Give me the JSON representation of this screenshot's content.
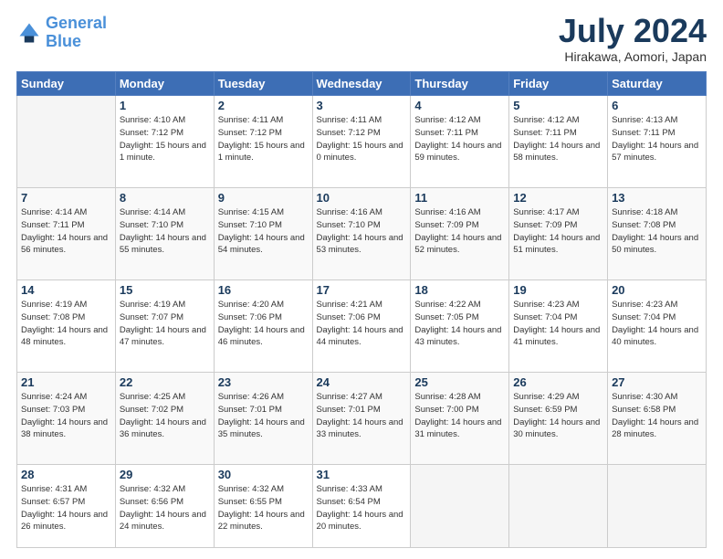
{
  "header": {
    "logo_line1": "General",
    "logo_line2": "Blue",
    "month_title": "July 2024",
    "location": "Hirakawa, Aomori, Japan"
  },
  "days_of_week": [
    "Sunday",
    "Monday",
    "Tuesday",
    "Wednesday",
    "Thursday",
    "Friday",
    "Saturday"
  ],
  "weeks": [
    [
      {
        "day": "",
        "empty": true
      },
      {
        "day": "1",
        "sunrise": "4:10 AM",
        "sunset": "7:12 PM",
        "daylight": "15 hours and 1 minute."
      },
      {
        "day": "2",
        "sunrise": "4:11 AM",
        "sunset": "7:12 PM",
        "daylight": "15 hours and 1 minute."
      },
      {
        "day": "3",
        "sunrise": "4:11 AM",
        "sunset": "7:12 PM",
        "daylight": "15 hours and 0 minutes."
      },
      {
        "day": "4",
        "sunrise": "4:12 AM",
        "sunset": "7:11 PM",
        "daylight": "14 hours and 59 minutes."
      },
      {
        "day": "5",
        "sunrise": "4:12 AM",
        "sunset": "7:11 PM",
        "daylight": "14 hours and 58 minutes."
      },
      {
        "day": "6",
        "sunrise": "4:13 AM",
        "sunset": "7:11 PM",
        "daylight": "14 hours and 57 minutes."
      }
    ],
    [
      {
        "day": "7",
        "sunrise": "4:14 AM",
        "sunset": "7:11 PM",
        "daylight": "14 hours and 56 minutes."
      },
      {
        "day": "8",
        "sunrise": "4:14 AM",
        "sunset": "7:10 PM",
        "daylight": "14 hours and 55 minutes."
      },
      {
        "day": "9",
        "sunrise": "4:15 AM",
        "sunset": "7:10 PM",
        "daylight": "14 hours and 54 minutes."
      },
      {
        "day": "10",
        "sunrise": "4:16 AM",
        "sunset": "7:10 PM",
        "daylight": "14 hours and 53 minutes."
      },
      {
        "day": "11",
        "sunrise": "4:16 AM",
        "sunset": "7:09 PM",
        "daylight": "14 hours and 52 minutes."
      },
      {
        "day": "12",
        "sunrise": "4:17 AM",
        "sunset": "7:09 PM",
        "daylight": "14 hours and 51 minutes."
      },
      {
        "day": "13",
        "sunrise": "4:18 AM",
        "sunset": "7:08 PM",
        "daylight": "14 hours and 50 minutes."
      }
    ],
    [
      {
        "day": "14",
        "sunrise": "4:19 AM",
        "sunset": "7:08 PM",
        "daylight": "14 hours and 48 minutes."
      },
      {
        "day": "15",
        "sunrise": "4:19 AM",
        "sunset": "7:07 PM",
        "daylight": "14 hours and 47 minutes."
      },
      {
        "day": "16",
        "sunrise": "4:20 AM",
        "sunset": "7:06 PM",
        "daylight": "14 hours and 46 minutes."
      },
      {
        "day": "17",
        "sunrise": "4:21 AM",
        "sunset": "7:06 PM",
        "daylight": "14 hours and 44 minutes."
      },
      {
        "day": "18",
        "sunrise": "4:22 AM",
        "sunset": "7:05 PM",
        "daylight": "14 hours and 43 minutes."
      },
      {
        "day": "19",
        "sunrise": "4:23 AM",
        "sunset": "7:04 PM",
        "daylight": "14 hours and 41 minutes."
      },
      {
        "day": "20",
        "sunrise": "4:23 AM",
        "sunset": "7:04 PM",
        "daylight": "14 hours and 40 minutes."
      }
    ],
    [
      {
        "day": "21",
        "sunrise": "4:24 AM",
        "sunset": "7:03 PM",
        "daylight": "14 hours and 38 minutes."
      },
      {
        "day": "22",
        "sunrise": "4:25 AM",
        "sunset": "7:02 PM",
        "daylight": "14 hours and 36 minutes."
      },
      {
        "day": "23",
        "sunrise": "4:26 AM",
        "sunset": "7:01 PM",
        "daylight": "14 hours and 35 minutes."
      },
      {
        "day": "24",
        "sunrise": "4:27 AM",
        "sunset": "7:01 PM",
        "daylight": "14 hours and 33 minutes."
      },
      {
        "day": "25",
        "sunrise": "4:28 AM",
        "sunset": "7:00 PM",
        "daylight": "14 hours and 31 minutes."
      },
      {
        "day": "26",
        "sunrise": "4:29 AM",
        "sunset": "6:59 PM",
        "daylight": "14 hours and 30 minutes."
      },
      {
        "day": "27",
        "sunrise": "4:30 AM",
        "sunset": "6:58 PM",
        "daylight": "14 hours and 28 minutes."
      }
    ],
    [
      {
        "day": "28",
        "sunrise": "4:31 AM",
        "sunset": "6:57 PM",
        "daylight": "14 hours and 26 minutes."
      },
      {
        "day": "29",
        "sunrise": "4:32 AM",
        "sunset": "6:56 PM",
        "daylight": "14 hours and 24 minutes."
      },
      {
        "day": "30",
        "sunrise": "4:32 AM",
        "sunset": "6:55 PM",
        "daylight": "14 hours and 22 minutes."
      },
      {
        "day": "31",
        "sunrise": "4:33 AM",
        "sunset": "6:54 PM",
        "daylight": "14 hours and 20 minutes."
      },
      {
        "day": "",
        "empty": true
      },
      {
        "day": "",
        "empty": true
      },
      {
        "day": "",
        "empty": true
      }
    ]
  ],
  "labels": {
    "sunrise": "Sunrise:",
    "sunset": "Sunset:",
    "daylight": "Daylight hours"
  }
}
